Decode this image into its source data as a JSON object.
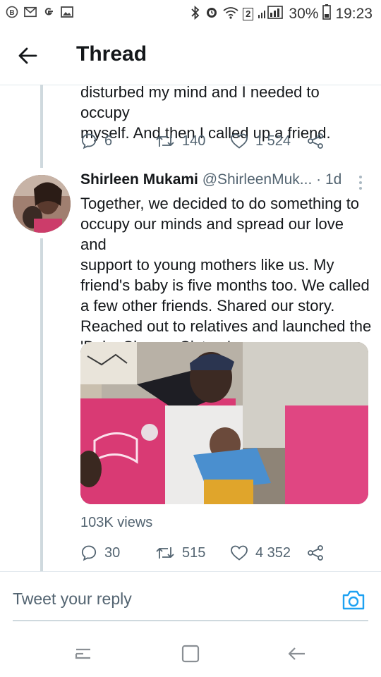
{
  "status_bar": {
    "notification_icons": [
      "b-icon",
      "mail-icon",
      "google-icon",
      "image-icon"
    ],
    "battery": "30%",
    "time": "19:23",
    "sim_badge": "2"
  },
  "header": {
    "title": "Thread"
  },
  "prev_tweet": {
    "text_line1": "disturbed my mind and I needed to occupy",
    "text_line2": "myself. And then I called up a friend.",
    "replies": "6",
    "retweets": "140",
    "likes": "1 524"
  },
  "tweet": {
    "name": "Shirleen Mukami",
    "handle": "@ShirleenMuk...",
    "time": "· 1d",
    "lines": [
      "Together, we decided to do something to",
      "occupy our minds and spread our love and",
      "support to young mothers like us. My",
      "friend's baby is five months too. We called",
      "a few other friends. Shared our story.",
      "Reached out to relatives and launched the",
      "'Baby Shower Sisters'."
    ],
    "views": "103K views",
    "replies": "30",
    "retweets": "515",
    "likes": "4 352"
  },
  "reply_bar": {
    "placeholder": "Tweet your reply"
  },
  "colors": {
    "accent": "#1da1f2",
    "muted": "#536471",
    "divider": "#e1e8ed"
  }
}
